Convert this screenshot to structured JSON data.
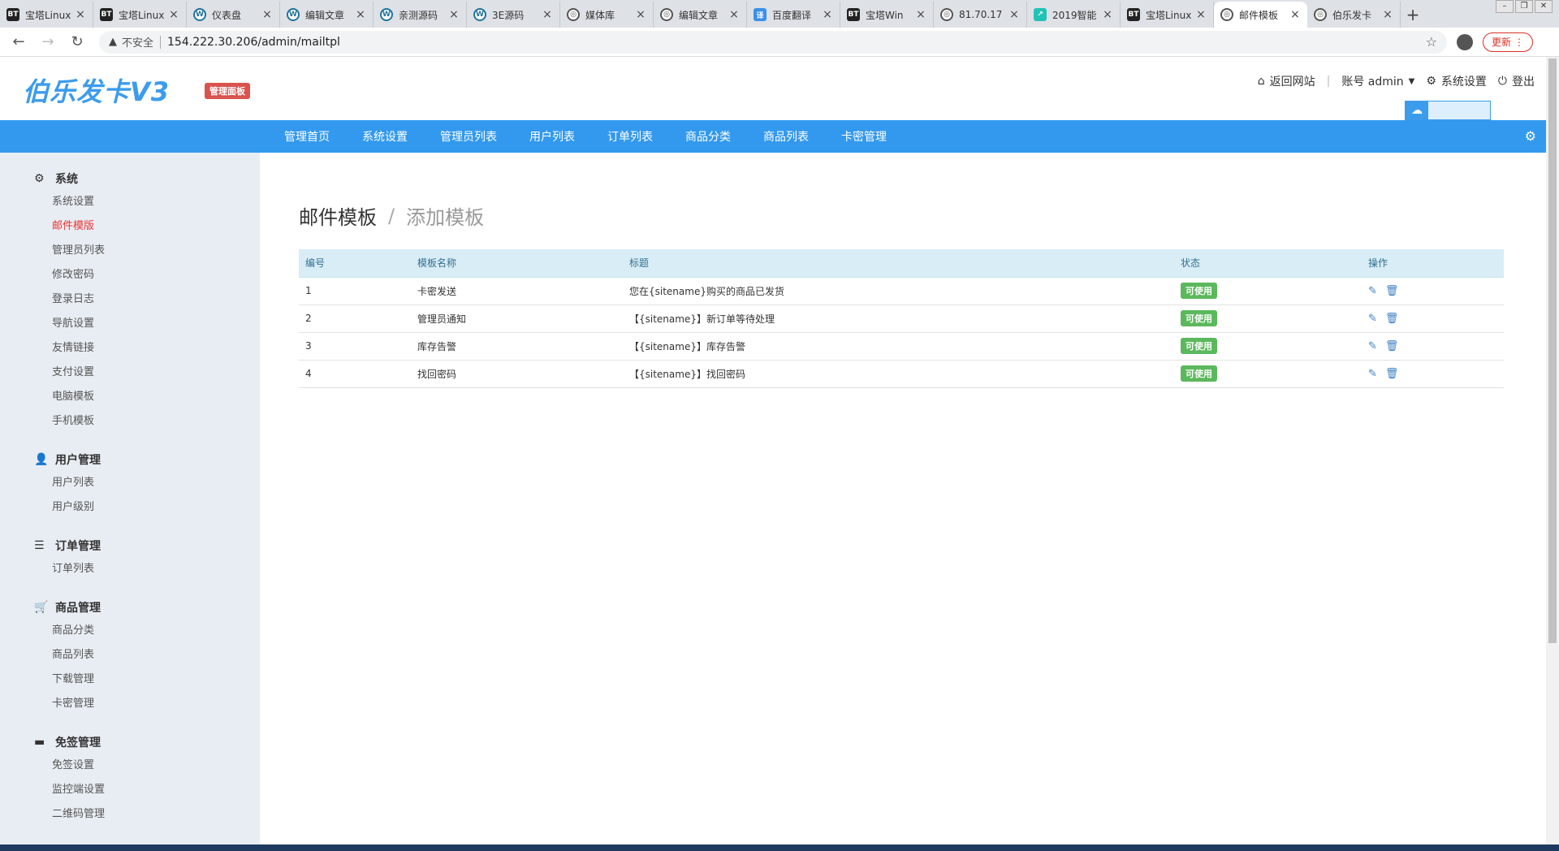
{
  "browser": {
    "tabs": [
      {
        "label": "宝塔Linux",
        "favicon": "bt-icon",
        "active": false
      },
      {
        "label": "宝塔Linux",
        "favicon": "bt-icon",
        "active": false
      },
      {
        "label": "仪表盘",
        "favicon": "wordpress-icon",
        "active": false
      },
      {
        "label": "编辑文章",
        "favicon": "wordpress-icon",
        "active": false
      },
      {
        "label": "亲测源码",
        "favicon": "wordpress-icon",
        "active": false
      },
      {
        "label": "3E源码",
        "favicon": "wordpress-icon",
        "active": false
      },
      {
        "label": "媒体库",
        "favicon": "globe-icon",
        "active": false
      },
      {
        "label": "编辑文章",
        "favicon": "globe-icon",
        "active": false
      },
      {
        "label": "百度翻译",
        "favicon": "translate-icon",
        "active": false
      },
      {
        "label": "宝塔Win",
        "favicon": "bt-icon",
        "active": false
      },
      {
        "label": "81.70.17",
        "favicon": "globe-icon",
        "active": false
      },
      {
        "label": "2019智能",
        "favicon": "chart-icon",
        "active": false
      },
      {
        "label": "宝塔Linux",
        "favicon": "bt-icon",
        "active": false
      },
      {
        "label": "邮件模板",
        "favicon": "globe-icon",
        "active": true
      },
      {
        "label": "伯乐发卡",
        "favicon": "globe-icon",
        "active": false
      }
    ],
    "insecure_label": "不安全",
    "url": "154.222.30.206/admin/mailtpl",
    "update_label": "更新"
  },
  "header": {
    "logo": "伯乐发卡V3",
    "badge": "管理面板",
    "links": {
      "back": "返回网站",
      "account": "账号 admin",
      "settings": "系统设置",
      "logout": "登出"
    }
  },
  "topnav": [
    "管理首页",
    "系统设置",
    "管理员列表",
    "用户列表",
    "订单列表",
    "商品分类",
    "商品列表",
    "卡密管理"
  ],
  "sidebar": [
    {
      "title": "系统",
      "icon": "gear-icon",
      "items": [
        "系统设置",
        "邮件模版",
        "管理员列表",
        "修改密码",
        "登录日志",
        "导航设置",
        "友情链接",
        "支付设置",
        "电脑模板",
        "手机模板"
      ],
      "active": "邮件模版"
    },
    {
      "title": "用户管理",
      "icon": "user-icon",
      "items": [
        "用户列表",
        "用户级别"
      ]
    },
    {
      "title": "订单管理",
      "icon": "list-icon",
      "items": [
        "订单列表"
      ]
    },
    {
      "title": "商品管理",
      "icon": "cart-icon",
      "items": [
        "商品分类",
        "商品列表",
        "下载管理",
        "卡密管理"
      ]
    },
    {
      "title": "免签管理",
      "icon": "card-icon",
      "items": [
        "免签设置",
        "监控端设置",
        "二维码管理"
      ]
    }
  ],
  "main": {
    "title": "邮件模板",
    "subtitle": "添加模板",
    "table": {
      "columns": [
        "编号",
        "模板名称",
        "标题",
        "状态",
        "操作"
      ],
      "rows": [
        {
          "id": "1",
          "name": "卡密发送",
          "subject": "您在{sitename}购买的商品已发货",
          "status": "可使用"
        },
        {
          "id": "2",
          "name": "管理员通知",
          "subject": "【{sitename}】新订单等待处理",
          "status": "可使用"
        },
        {
          "id": "3",
          "name": "库存告警",
          "subject": "【{sitename}】库存告警",
          "status": "可使用"
        },
        {
          "id": "4",
          "name": "找回密码",
          "subject": "【{sitename}】找回密码",
          "status": "可使用"
        }
      ]
    }
  }
}
